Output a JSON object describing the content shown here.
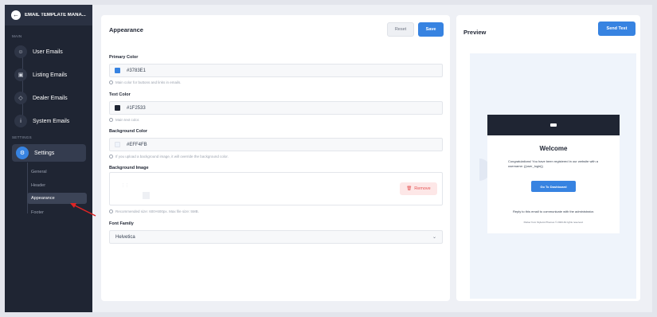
{
  "sidebar": {
    "header_title": "EMAIL TEMPLATE MANA...",
    "section_main": "MAIN",
    "section_settings": "SETTINGS",
    "items": [
      {
        "label": "User Emails",
        "icon": "user-icon"
      },
      {
        "label": "Listing Emails",
        "icon": "truck-icon"
      },
      {
        "label": "Dealer Emails",
        "icon": "tag-icon"
      },
      {
        "label": "System Emails",
        "icon": "info-icon"
      }
    ],
    "active_item": {
      "label": "Settings",
      "icon": "gear-icon"
    },
    "sub_items": [
      "General",
      "Header",
      "Appearance",
      "Footer"
    ],
    "active_sub": "Appearance"
  },
  "appearance": {
    "title": "Appearance",
    "reset_label": "Reset",
    "save_label": "Save",
    "primary_label": "Primary Color",
    "primary_value": "#3783E1",
    "primary_hint": "Main color for buttons and links in emails.",
    "text_label": "Text Color",
    "text_value": "#1F2533",
    "text_hint": "Main text color.",
    "bg_label": "Background Color",
    "bg_value": "#EFF4FB",
    "bg_hint": "If you upload a background image, it will override the background color.",
    "bgimg_label": "Background Image",
    "remove_label": "Remove",
    "bgimg_hint": "Recommended size: 600×600px. Max file size: 5MB.",
    "font_label": "Font Family",
    "font_value": "Helvetica"
  },
  "preview": {
    "title": "Preview",
    "send_label": "Send Test",
    "email_title": "Welcome",
    "email_text": "Congratulations! You have been registered in our website with a username: {{user_login}}",
    "email_button": "Go To Dashboard",
    "email_reply": "Reply to this email to communicate with the administrator.",
    "email_footer": "Parker from StylemixThemes © 2023 All rights reserved."
  },
  "colors": {
    "primary": "#3783E1",
    "text": "#1F2533",
    "background": "#EFF4FB",
    "danger": "#E55555"
  }
}
